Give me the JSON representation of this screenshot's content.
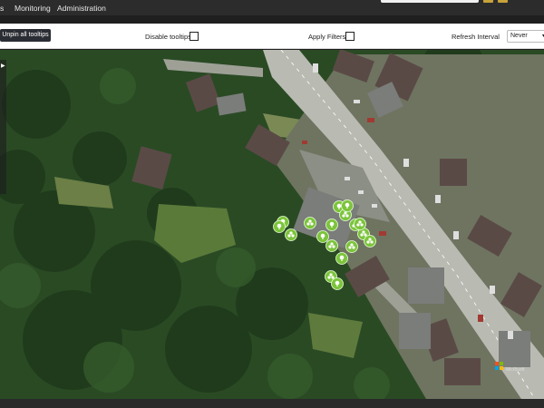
{
  "nav": {
    "items": [
      "s",
      "Monitoring",
      "Administration"
    ]
  },
  "toolbar": {
    "unpin_label": "Unpin all tooltips",
    "disable_tooltips_label": "Disable tooltips",
    "apply_filters_label": "Apply Filters",
    "refresh_interval_label": "Refresh Interval",
    "refresh_interval_value": "Never",
    "disable_tooltips_checked": false,
    "apply_filters_checked": false
  },
  "map": {
    "type": "satellite-imagery",
    "markers": [
      {
        "icon": "tree-icon"
      },
      {
        "icon": "tree-group-icon"
      },
      {
        "icon": "tree-group-icon"
      },
      {
        "icon": "tree-icon"
      },
      {
        "icon": "tree-icon"
      },
      {
        "icon": "tree-group-icon"
      },
      {
        "icon": "tree-group-icon"
      },
      {
        "icon": "tree-icon"
      },
      {
        "icon": "tree-group-icon"
      },
      {
        "icon": "tree-group-icon"
      },
      {
        "icon": "tree-group-icon"
      },
      {
        "icon": "tree-group-icon"
      },
      {
        "icon": "tree-icon"
      },
      {
        "icon": "tree-group-icon"
      },
      {
        "icon": "tree-icon"
      },
      {
        "icon": "tree-icon"
      },
      {
        "icon": "tree-group-icon"
      },
      {
        "icon": "tree-icon"
      }
    ],
    "marker_color": "#7cc43c",
    "attribution": "Microsoft"
  },
  "colors": {
    "nav_bg": "#2c2c2c",
    "button_dark": "#2a2d33",
    "accent_yellow": "#c8a23a"
  }
}
